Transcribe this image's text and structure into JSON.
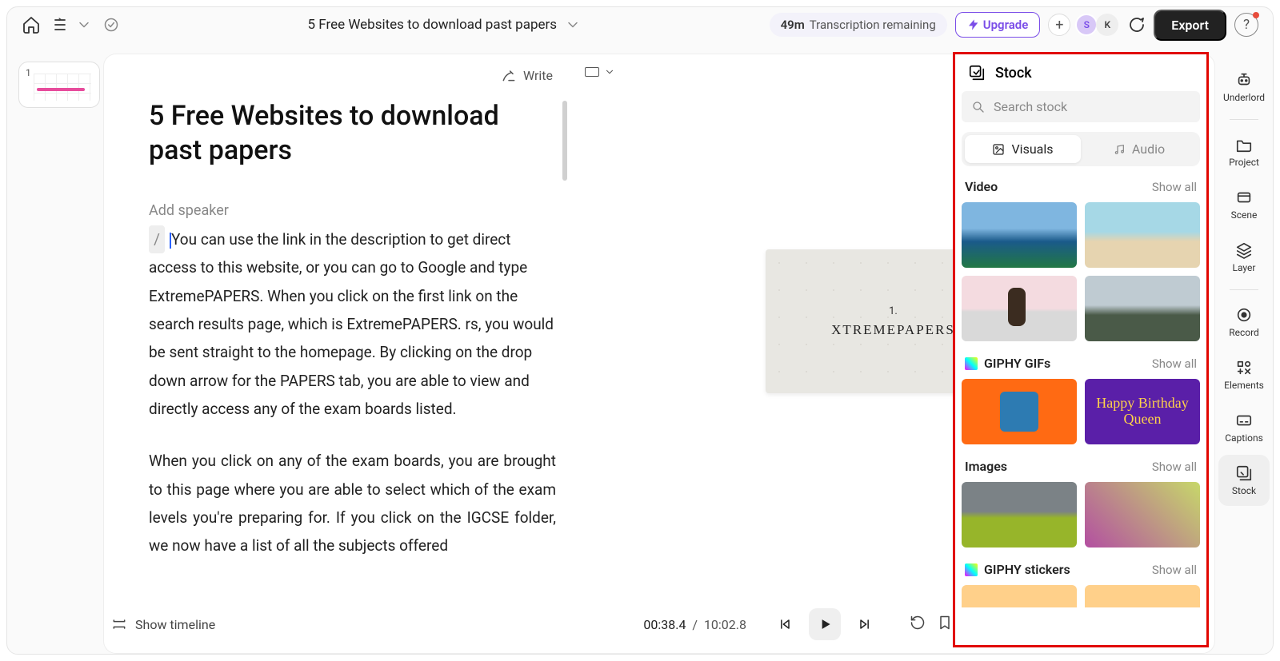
{
  "topbar": {
    "doc_title": "5 Free Websites to download past papers",
    "transcription_minutes": "49m",
    "transcription_label": "Transcription remaining",
    "upgrade_label": "Upgrade",
    "avatar1": "S",
    "avatar2": "K",
    "export_label": "Export",
    "help_label": "?"
  },
  "slides": {
    "first_number": "1"
  },
  "transcript": {
    "write_label": "Write",
    "heading": "5 Free Websites to download past papers",
    "add_speaker": "Add speaker",
    "slash": "/",
    "para1a": "You can use the link in the description to get direct access to this website, or you can go to Google and type ExtremePAPERS. When you click on the first link on the search results page, which is ExtremePAPERS. rs, you would be sent straight to the homepage. By clicking on the drop down arrow for the PAPERS tab, you are able to view and directly access any of the exam boards listed.",
    "para2": "When you click on any of the exam boards, you are brought to this page where you are able to select which of the exam levels you're preparing for. If you click on the IGCSE folder, we now have a list of all the subjects offered"
  },
  "preview": {
    "canvas_number": "1.",
    "canvas_title": "XTREMEPAPERS"
  },
  "stock": {
    "title": "Stock",
    "search_placeholder": "Search stock",
    "tab_visuals": "Visuals",
    "tab_audio": "Audio",
    "sections": {
      "video": {
        "label": "Video",
        "showall": "Show all"
      },
      "giphy_gifs": {
        "label": "GIPHY GIFs",
        "showall": "Show all",
        "birthday_text": "Happy Birthday Queen"
      },
      "images": {
        "label": "Images",
        "showall": "Show all"
      },
      "giphy_stickers": {
        "label": "GIPHY stickers",
        "showall": "Show all"
      }
    }
  },
  "rail": {
    "underlord": "Underlord",
    "project": "Project",
    "scene": "Scene",
    "layer": "Layer",
    "record": "Record",
    "elements": "Elements",
    "captions": "Captions",
    "stock": "Stock"
  },
  "playbar": {
    "show_timeline": "Show timeline",
    "current_time": "00:38.4",
    "sep": "/",
    "total_time": "10:02.8"
  }
}
